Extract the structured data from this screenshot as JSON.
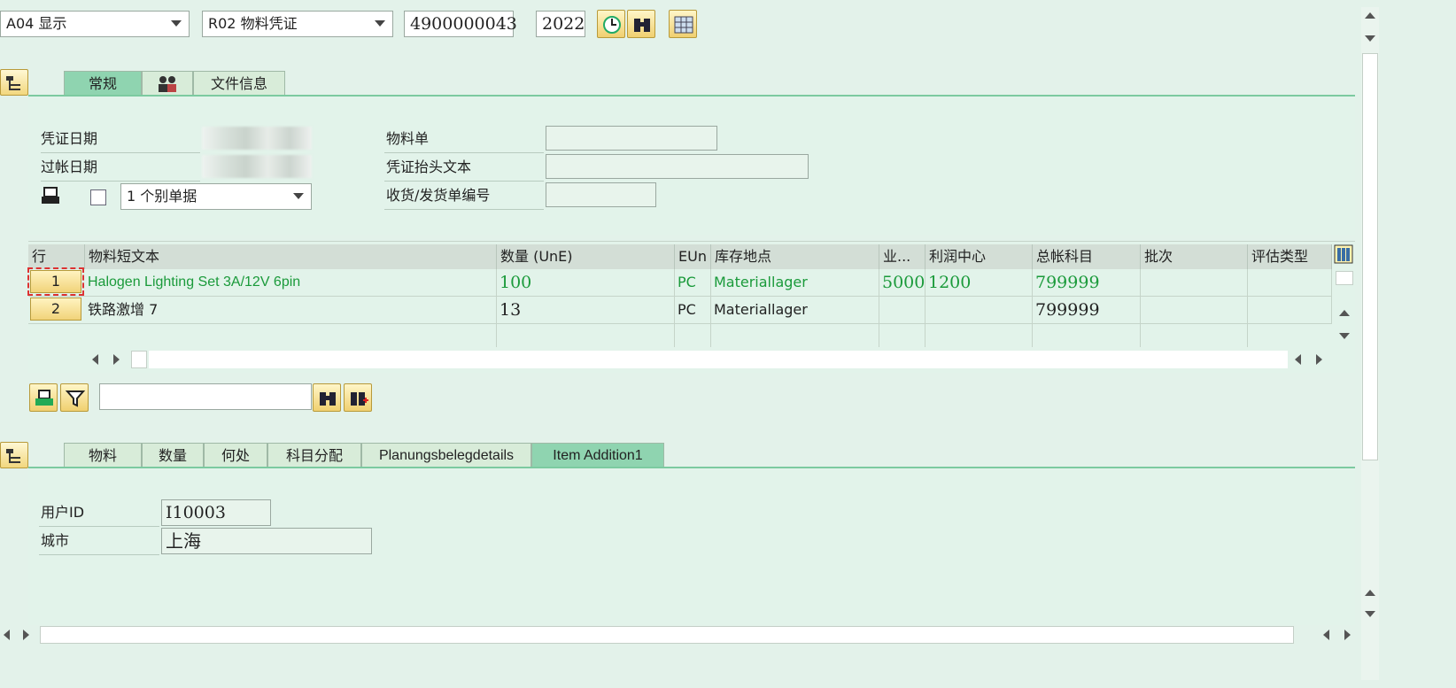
{
  "toolbar": {
    "action": "A04 显示",
    "reference": "R02 物料凭证",
    "doc_number": "4900000043",
    "year": "2022"
  },
  "header_tabs": [
    "常规",
    "",
    "文件信息"
  ],
  "header": {
    "doc_date_label": "凭证日期",
    "post_date_label": "过帐日期",
    "print_option": "1 个别单据",
    "material_slip_label": "物料单",
    "header_text_label": "凭证抬头文本",
    "delivery_note_label": "收货/发货单编号"
  },
  "table": {
    "columns": [
      "行",
      "物料短文本",
      "数量 (UnE)",
      "EUn",
      "库存地点",
      "业...",
      "利润中心",
      "总帐科目",
      "批次",
      "评估类型"
    ],
    "rows": [
      {
        "line": "1",
        "text": "Halogen Lighting Set 3A/12V 6pin",
        "qty": "100",
        "eun": "PC",
        "sloc": "Materiallager",
        "biz": "5000",
        "profit": "1200",
        "gl": "799999",
        "batch": "",
        "val": ""
      },
      {
        "line": "2",
        "text": "铁路激增 7",
        "qty": "13",
        "eun": "PC",
        "sloc": "Materiallager",
        "biz": "",
        "profit": "",
        "gl": "799999",
        "batch": "",
        "val": ""
      }
    ]
  },
  "search": {
    "value": ""
  },
  "detail_tabs": [
    "物料",
    "数量",
    "何处",
    "科目分配",
    "Planungsbelegdetails",
    "Item Addition1"
  ],
  "detail": {
    "user_id_label": "用户ID",
    "user_id": "I10003",
    "city_label": "城市",
    "city": "上海"
  }
}
